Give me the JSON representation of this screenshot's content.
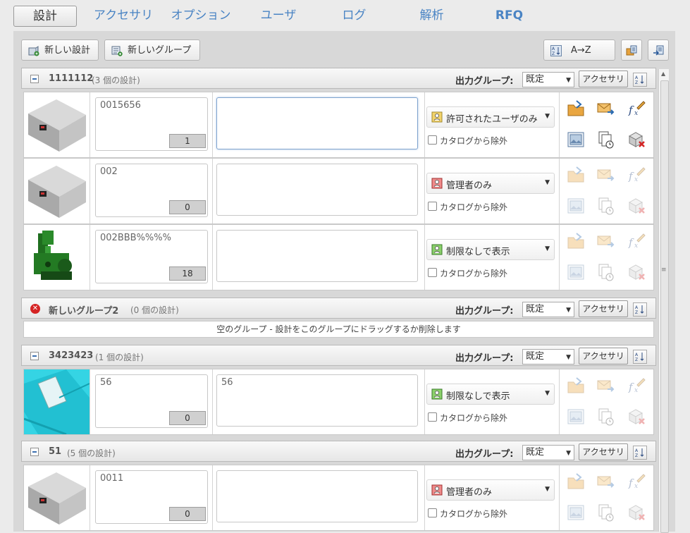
{
  "tabs": [
    "設計",
    "アクセサリ",
    "オプション",
    "ユーザ",
    "ログ",
    "解析",
    "RFQ"
  ],
  "toolbar": {
    "new_design": "新しい設計",
    "new_group": "新しいグループ",
    "sort_az": "A→Z"
  },
  "common": {
    "output_group_label": "出力グループ:",
    "output_group_value": "既定",
    "accessory_button": "アクセサリ",
    "exclude_catalog": "カタログから除外"
  },
  "groups": [
    {
      "name": "1111112",
      "count": "(3 個の設計)",
      "rows": [
        {
          "name": "0015656",
          "count": "1",
          "description": "",
          "visibility": "許可されたユーザのみ",
          "thumb": "box"
        },
        {
          "name": "002",
          "count": "0",
          "description": "",
          "visibility": "管理者のみ",
          "thumb": "box"
        },
        {
          "name": "002BBB%%%%",
          "count": "18",
          "description": "",
          "visibility": "制限なしで表示",
          "thumb": "machine"
        }
      ]
    },
    {
      "name": "新しいグループ2",
      "count": "(0 個の設計)",
      "empty_text": "空のグループ - 設計をこのグループにドラッグするか削除します"
    },
    {
      "name": "3423423",
      "count": "(1 個の設計)",
      "rows": [
        {
          "name": "56",
          "count": "0",
          "description": "56",
          "visibility": "制限なしで表示",
          "thumb": "cyan"
        }
      ]
    },
    {
      "name": "51",
      "count": "(5 個の設計)",
      "rows": [
        {
          "name": "0011",
          "count": "0",
          "description": "",
          "visibility": "管理者のみ",
          "thumb": "box"
        }
      ]
    }
  ],
  "colors": {
    "tab_link": "#4a84c4",
    "remove_icon": "#d52424"
  }
}
